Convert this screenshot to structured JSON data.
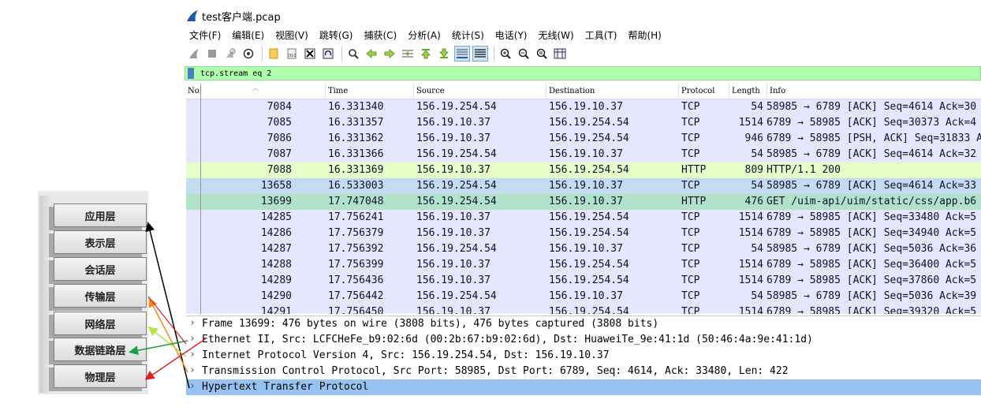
{
  "window": {
    "title": "test客户端.pcap"
  },
  "menu": [
    "文件(F)",
    "编辑(E)",
    "视图(V)",
    "跳转(G)",
    "捕获(C)",
    "分析(A)",
    "统计(S)",
    "电话(Y)",
    "无线(W)",
    "工具(T)",
    "帮助(H)"
  ],
  "toolbar": {
    "icons": [
      "start-capture-icon",
      "stop-capture-icon",
      "restart-capture-icon",
      "capture-options-icon",
      "open-file-icon",
      "save-file-icon",
      "close-file-icon",
      "reload-file-icon",
      "find-packet-icon",
      "go-back-icon",
      "go-forward-icon",
      "go-to-packet-icon",
      "go-first-icon",
      "go-last-icon",
      "auto-scroll-icon",
      "colorize-icon",
      "zoom-in-icon",
      "zoom-out-icon",
      "zoom-reset-icon",
      "resize-columns-icon"
    ]
  },
  "filter": {
    "text": "tcp.stream eq 2",
    "bar_color": "#afffaf"
  },
  "columns": [
    "No.",
    "Time",
    "Source",
    "Destination",
    "Protocol",
    "Length",
    "Info"
  ],
  "packets": [
    {
      "no": "7084",
      "time": "16.331340",
      "src": "156.19.254.54",
      "dst": "156.19.10.37",
      "proto": "TCP",
      "len": "54",
      "info": "58985 → 6789 [ACK] Seq=4614 Ack=30"
    },
    {
      "no": "7085",
      "time": "16.331357",
      "src": "156.19.10.37",
      "dst": "156.19.254.54",
      "proto": "TCP",
      "len": "1514",
      "info": "6789 → 58985 [ACK] Seq=30373 Ack=4"
    },
    {
      "no": "7086",
      "time": "16.331362",
      "src": "156.19.10.37",
      "dst": "156.19.254.54",
      "proto": "TCP",
      "len": "946",
      "info": "6789 → 58985 [PSH, ACK] Seq=31833 A"
    },
    {
      "no": "7087",
      "time": "16.331366",
      "src": "156.19.254.54",
      "dst": "156.19.10.37",
      "proto": "TCP",
      "len": "54",
      "info": "58985 → 6789 [ACK] Seq=4614 Ack=32"
    },
    {
      "no": "7088",
      "time": "16.331369",
      "src": "156.19.10.37",
      "dst": "156.19.254.54",
      "proto": "HTTP",
      "len": "809",
      "info": "HTTP/1.1 200"
    },
    {
      "no": "13658",
      "time": "16.533003",
      "src": "156.19.254.54",
      "dst": "156.19.10.37",
      "proto": "TCP",
      "len": "54",
      "info": "58985 → 6789 [ACK] Seq=4614 Ack=33"
    },
    {
      "no": "13699",
      "time": "17.747048",
      "src": "156.19.254.54",
      "dst": "156.19.10.37",
      "proto": "HTTP",
      "len": "476",
      "info": "GET /uim-api/uim/static/css/app.b6"
    },
    {
      "no": "14285",
      "time": "17.756241",
      "src": "156.19.10.37",
      "dst": "156.19.254.54",
      "proto": "TCP",
      "len": "1514",
      "info": "6789 → 58985 [ACK] Seq=33480 Ack=5"
    },
    {
      "no": "14286",
      "time": "17.756379",
      "src": "156.19.10.37",
      "dst": "156.19.254.54",
      "proto": "TCP",
      "len": "1514",
      "info": "6789 → 58985 [ACK] Seq=34940 Ack=5"
    },
    {
      "no": "14287",
      "time": "17.756392",
      "src": "156.19.254.54",
      "dst": "156.19.10.37",
      "proto": "TCP",
      "len": "54",
      "info": "58985 → 6789 [ACK] Seq=5036 Ack=36"
    },
    {
      "no": "14288",
      "time": "17.756399",
      "src": "156.19.10.37",
      "dst": "156.19.254.54",
      "proto": "TCP",
      "len": "1514",
      "info": "6789 → 58985 [ACK] Seq=36400 Ack=5"
    },
    {
      "no": "14289",
      "time": "17.756436",
      "src": "156.19.10.37",
      "dst": "156.19.254.54",
      "proto": "TCP",
      "len": "1514",
      "info": "6789 → 58985 [ACK] Seq=37860 Ack=5"
    },
    {
      "no": "14290",
      "time": "17.756442",
      "src": "156.19.254.54",
      "dst": "156.19.10.37",
      "proto": "TCP",
      "len": "54",
      "info": "58985 → 6789 [ACK] Seq=5036 Ack=39"
    },
    {
      "no": "14291",
      "time": "17.756450",
      "src": "156.19.10.37",
      "dst": "156.19.254.54",
      "proto": "TCP",
      "len": "1514",
      "info": "6789 → 58985 [ACK] Seq=39320 Ack=5"
    }
  ],
  "details": [
    "Frame 13699: 476 bytes on wire (3808 bits), 476 bytes captured (3808 bits)",
    "Ethernet II, Src: LCFCHeFe_b9:02:6d (00:2b:67:b9:02:6d), Dst: HuaweiTe_9e:41:1d (50:46:4a:9e:41:1d)",
    "Internet Protocol Version 4, Src: 156.19.254.54, Dst: 156.19.10.37",
    "Transmission Control Protocol, Src Port: 58985, Dst Port: 6789, Seq: 4614, Ack: 33480, Len: 422",
    "Hypertext Transfer Protocol"
  ],
  "osi_layers": [
    "应用层",
    "表示层",
    "会话层",
    "传输层",
    "网络层",
    "数据链路层",
    "物理层"
  ],
  "colors": {
    "tcp_row": "#e7e6ff",
    "http_row": "#e4ffc7",
    "selected_row": "#c4dcf0",
    "marked_row": "#b0e3c9",
    "detail_selected": "#96c3f2",
    "arrow_app": "#000000",
    "arrow_transport": "#f08a1c",
    "arrow_network": "#b8e04a",
    "arrow_datalink": "#1aa040",
    "arrow_physical": "#e02020"
  }
}
